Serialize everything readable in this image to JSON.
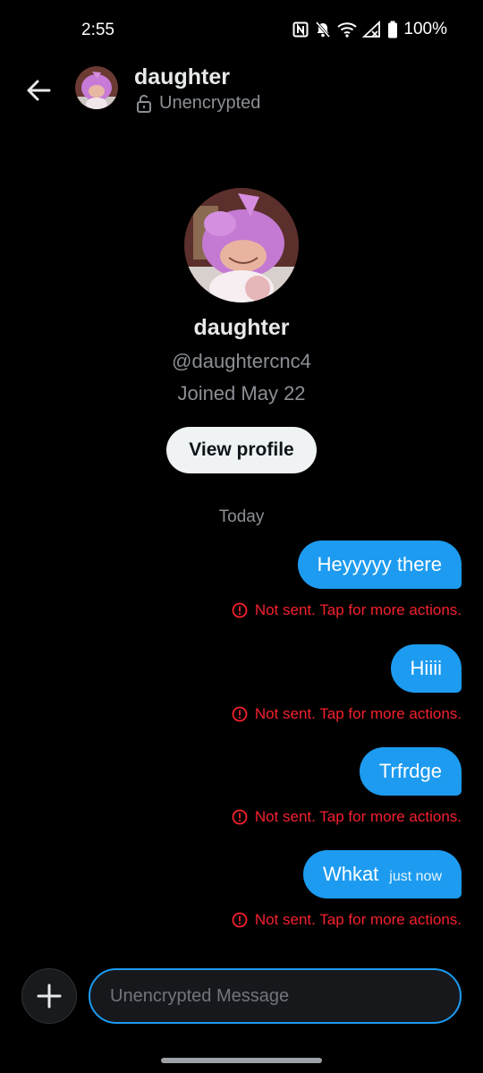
{
  "status_bar": {
    "time": "2:55",
    "battery": "100%"
  },
  "header": {
    "back_icon": "arrow-left-icon",
    "name": "daughter",
    "encryption_label": "Unencrypted"
  },
  "profile": {
    "name": "daughter",
    "handle": "@daughtercnc4",
    "joined": "Joined May 22",
    "view_profile_label": "View profile"
  },
  "date_divider": "Today",
  "messages": [
    {
      "text": "Heyyyyy there",
      "timestamp": "",
      "error": "Not sent. Tap for more actions."
    },
    {
      "text": "Hiiii",
      "timestamp": "",
      "error": "Not sent. Tap for more actions."
    },
    {
      "text": "Trfrdge",
      "timestamp": "",
      "error": "Not sent. Tap for more actions."
    },
    {
      "text": "Whkat",
      "timestamp": "just now",
      "error": "Not sent. Tap for more actions."
    }
  ],
  "composer": {
    "placeholder": "Unencrypted Message",
    "value": ""
  },
  "colors": {
    "accent": "#1d9bf0",
    "error": "#f4212e",
    "background": "#000000"
  }
}
